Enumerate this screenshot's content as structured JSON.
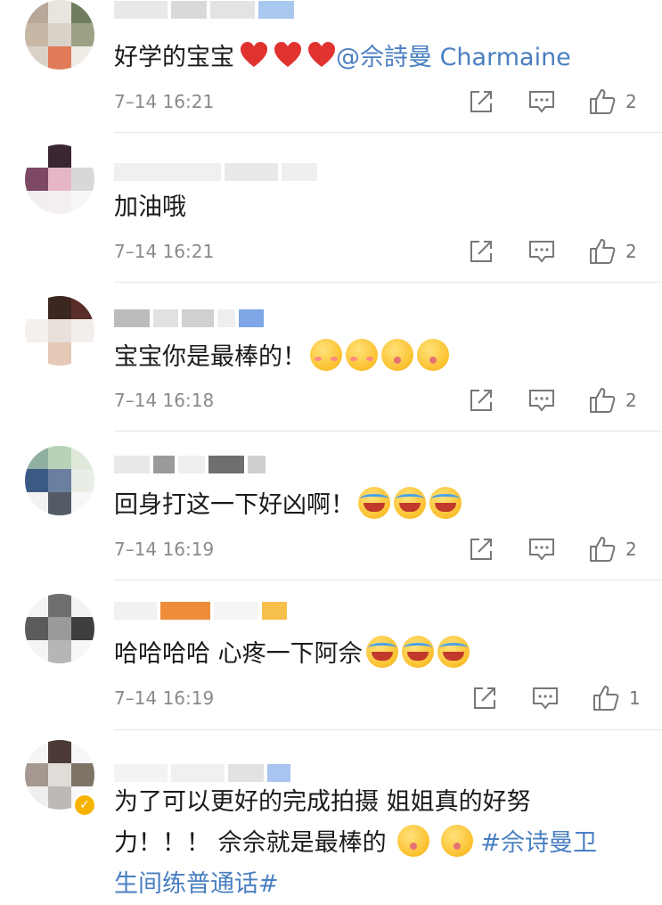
{
  "comments": [
    {
      "text": "好学的宝宝",
      "hearts": 3,
      "mention": "@佘詩曼 Charmaine",
      "time": "7–14 16:21",
      "likes": "2"
    },
    {
      "text": "加油哦",
      "time": "7–14 16:21",
      "likes": "2"
    },
    {
      "text": "宝宝你是最棒的！",
      "emojis": [
        "shy",
        "shy",
        "kiss",
        "kiss"
      ],
      "time": "7–14 16:18",
      "likes": "2"
    },
    {
      "text": "回身打这一下好凶啊！",
      "emojis": [
        "cry",
        "cry",
        "cry"
      ],
      "time": "7–14 16:19",
      "likes": "2"
    },
    {
      "text": "哈哈哈哈 心疼一下阿佘",
      "emojis": [
        "cry",
        "cry",
        "cry"
      ],
      "time": "7–14 16:19",
      "likes": "1"
    },
    {
      "text_line1": "为了可以更好的完成拍摄 姐姐真的好努",
      "text_line2_prefix": "力！！！ 佘佘就是最棒的",
      "topic_line2": "#佘诗曼卫",
      "topic_line3": "生间练普通话#",
      "emojis": [
        "kiss",
        "kiss"
      ]
    }
  ],
  "colors": {
    "link": "#4a7fc1",
    "heart": "#e0322f",
    "verified_badge": "#f6b400"
  },
  "icons": {
    "share": "share-icon",
    "comment": "comment-icon",
    "like": "thumbs-up-icon"
  }
}
